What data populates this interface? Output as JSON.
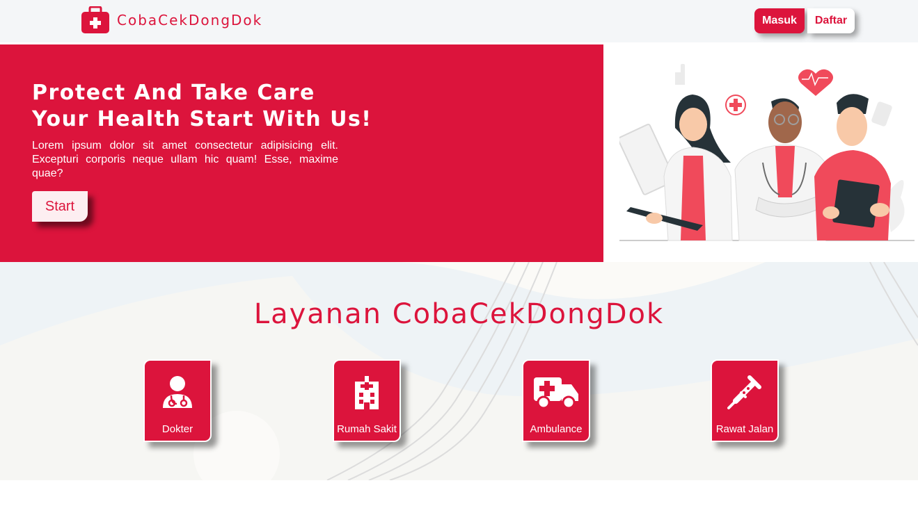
{
  "navbar": {
    "brand": "CobaCekDongDok",
    "brand_icon": "first-aid-kit-icon",
    "login_label": "Masuk",
    "register_label": "Daftar"
  },
  "hero": {
    "title_line1": "Protect And Take Care",
    "title_line2": "Your Health Start With Us!",
    "description": "Lorem ipsum dolor sit amet consectetur adipisicing elit. Excepturi corporis neque ullam hic quam! Esse, maxime quae?",
    "start_label": "Start",
    "illustration": "medical-team-illustration"
  },
  "services": {
    "title": "Layanan CobaCekDongDok",
    "items": [
      {
        "label": "Dokter",
        "icon": "doctor-icon"
      },
      {
        "label": "Rumah Sakit",
        "icon": "hospital-icon"
      },
      {
        "label": "Ambulance",
        "icon": "ambulance-icon"
      },
      {
        "label": "Rawat Jalan",
        "icon": "crutch-icon"
      }
    ]
  },
  "colors": {
    "primary": "#dc143c",
    "navbar_bg": "#f4f6f8",
    "services_bg": "#eef3f6"
  }
}
